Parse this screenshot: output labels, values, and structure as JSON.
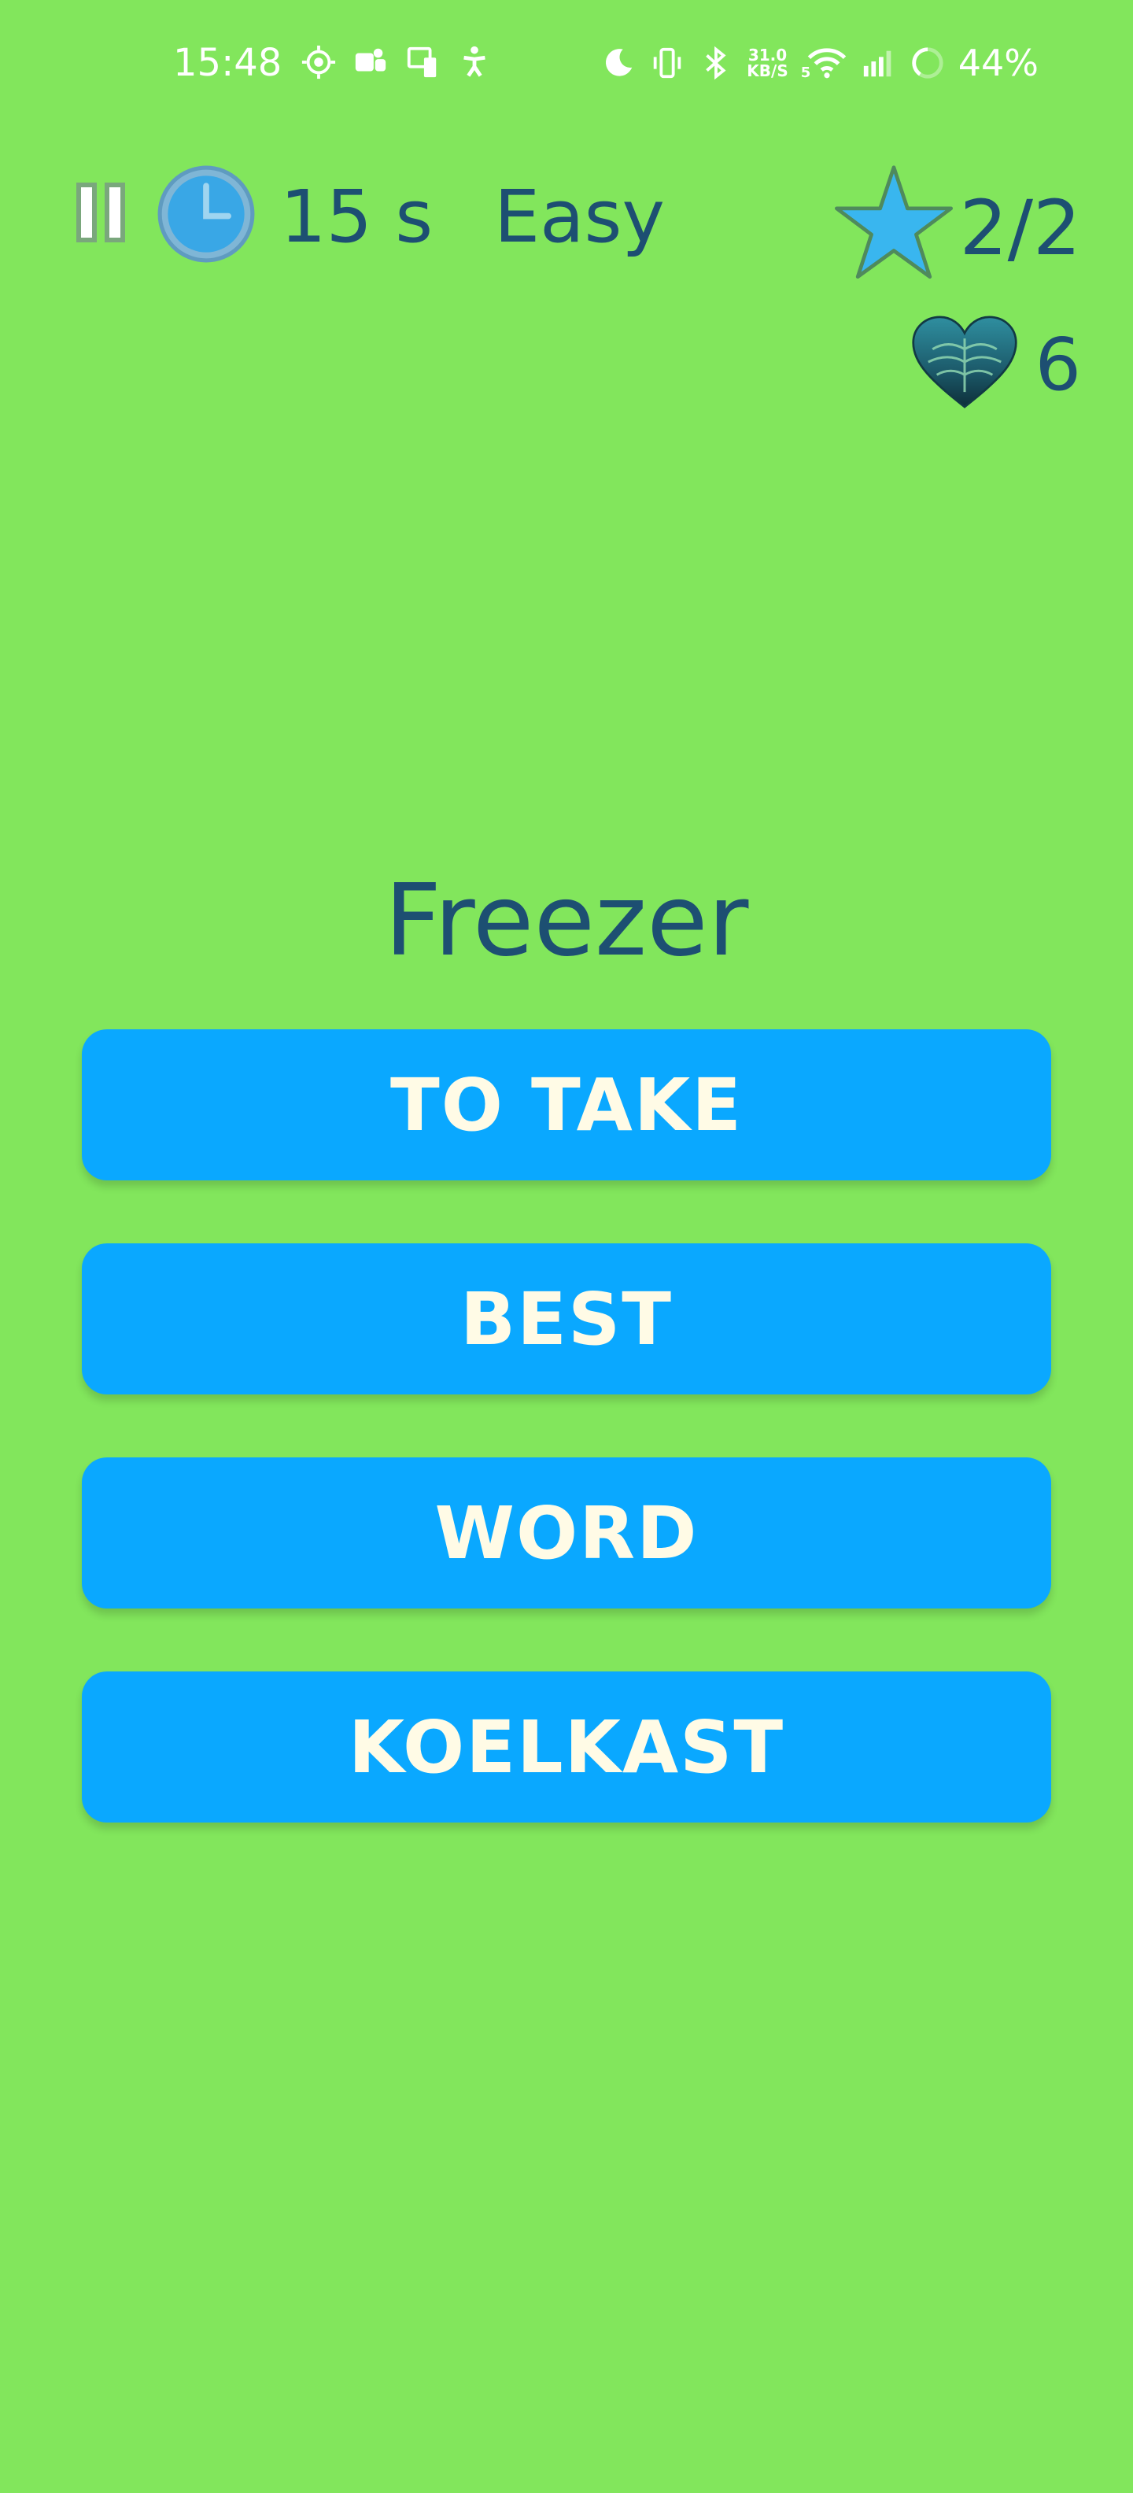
{
  "status_bar": {
    "time": "15:48",
    "net_speed_value": "31.0",
    "net_speed_unit": "KB/S",
    "wifi_badge": "5",
    "battery": "44%",
    "left_icons": [
      "settings-gear-icon",
      "teams-icon",
      "phone-link-icon",
      "accessibility-icon"
    ],
    "right_icons": [
      "moon-icon",
      "vibrate-icon",
      "bluetooth-icon",
      "wifi-icon",
      "signal-icon",
      "battery-ring-icon"
    ]
  },
  "header": {
    "timer": "15 s",
    "difficulty": "Easy",
    "score": "2/2",
    "lives": "6"
  },
  "question": {
    "word": "Freezer"
  },
  "answers": [
    {
      "label": "TO TAKE"
    },
    {
      "label": "BEST"
    },
    {
      "label": "WORD"
    },
    {
      "label": "KOELKAST"
    }
  ],
  "colors": {
    "background": "#82e65c",
    "button": "#0aa8ff",
    "button_text": "#fffbe6",
    "text": "#1d4f72",
    "star": "#39b6ef"
  }
}
